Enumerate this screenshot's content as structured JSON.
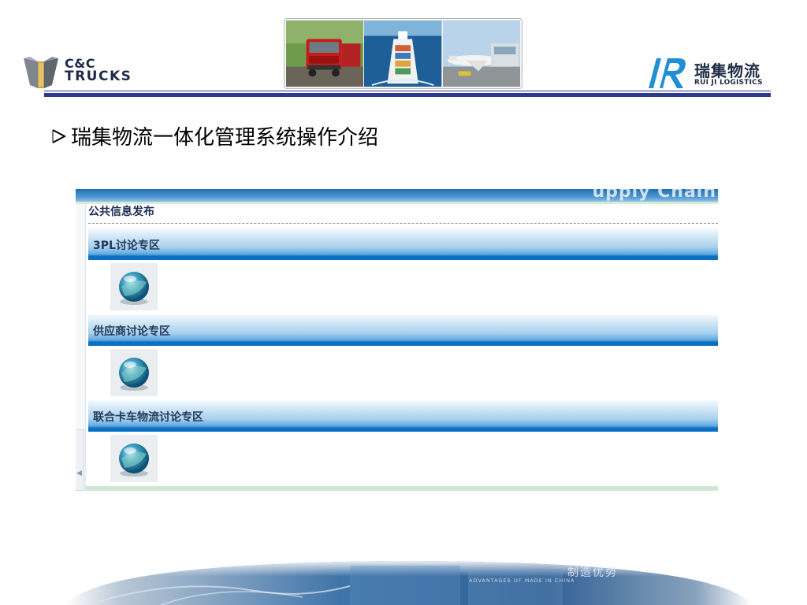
{
  "header": {
    "left_logo": {
      "line1": "C&C",
      "line2": "TRUCKS",
      "icon": "cc-trucks-logo-icon"
    },
    "banner": {
      "panels": [
        "truck-photo",
        "container-ship-photo",
        "airplane-photo"
      ]
    },
    "right_logo": {
      "cn_name": "瑞集物流",
      "en_name": "RUI JI LOGISTICS",
      "icon": "rj-logo-icon"
    },
    "colors": {
      "rule": "#2d3a8c"
    }
  },
  "slide": {
    "title": "瑞集物流一体化管理系统操作介绍",
    "bullet_icon": "arrow-bullet-icon"
  },
  "screenshot": {
    "top_banner_text": "upply Chain",
    "public_info_label": "公共信息发布",
    "sections": [
      {
        "label": "3PL讨论专区",
        "icon": "forum-globe-icon"
      },
      {
        "label": "供应商讨论专区",
        "icon": "forum-globe-icon"
      },
      {
        "label": "联合卡车物流讨论专区",
        "icon": "forum-globe-icon"
      }
    ],
    "colors": {
      "bar_dark": "#0b6fc4",
      "bar_light": "#a7d0ee"
    }
  },
  "footer": {
    "cn_text": "制造优势",
    "en_text": "ADVANTAGES OF MADE IN CHINA"
  }
}
